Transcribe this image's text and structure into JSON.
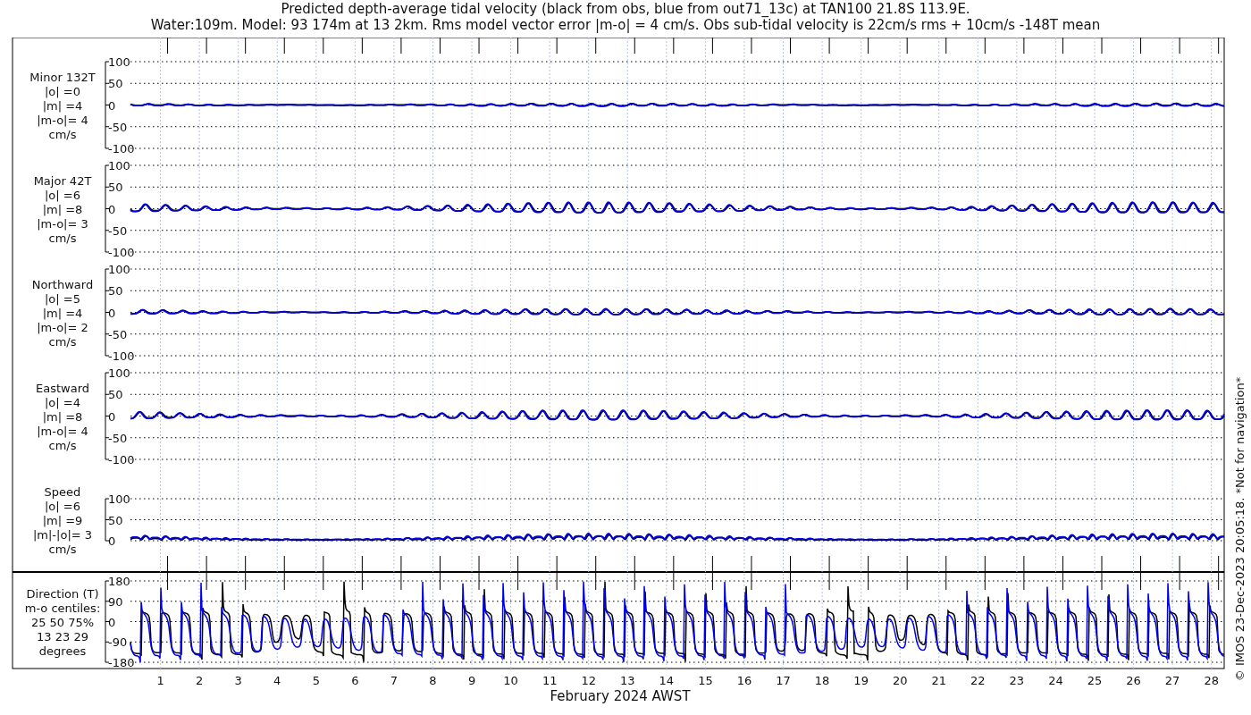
{
  "title_lines": [
    "Predicted depth-average tidal velocity (black from obs, blue from out71_13c) at TAN100 21.8S 113.9E.",
    "Water:109m. Model: 93 174m at 13 2km. Rms model vector error |m-o| = 4 cm/s. Obs sub-tidal velocity is 22cm/s rms + 10cm/s -148T mean"
  ],
  "panels": [
    {
      "kind": "velocity",
      "label": [
        "Minor 132T",
        "|o| =0",
        "|m| =4",
        "|m-o|= 4",
        "cm/s"
      ],
      "yticks": [
        "100",
        "50",
        "0",
        "-50",
        "-100"
      ]
    },
    {
      "kind": "velocity",
      "label": [
        "Major 42T",
        "|o| =6",
        "|m| =8",
        "|m-o|= 3",
        "cm/s"
      ],
      "yticks": [
        "100",
        "50",
        "0",
        "-50",
        "-100"
      ]
    },
    {
      "kind": "velocity",
      "label": [
        "Northward",
        "|o| =5",
        "|m| =4",
        "|m-o|= 2",
        "cm/s"
      ],
      "yticks": [
        "100",
        "50",
        "0",
        "-50",
        "-100"
      ]
    },
    {
      "kind": "velocity",
      "label": [
        "Eastward",
        "|o| =4",
        "|m| =8",
        "|m-o|= 4",
        "cm/s"
      ],
      "yticks": [
        "100",
        "50",
        "0",
        "-50",
        "-100"
      ]
    },
    {
      "kind": "speed",
      "label": [
        "Speed",
        "|o| =6",
        "|m| =9",
        "|m|-|o|= 3",
        "cm/s"
      ],
      "yticks": [
        "100",
        "50",
        "0"
      ]
    },
    {
      "kind": "direction",
      "label": [
        "Direction (T)",
        "m-o centiles:",
        "25  50  75%",
        "13  23  29",
        "degrees"
      ],
      "yticks": [
        "180",
        "90",
        "0",
        "-90",
        "-180"
      ]
    }
  ],
  "x_tick_labels": [
    "1",
    "2",
    "3",
    "4",
    "5",
    "6",
    "7",
    "8",
    "9",
    "10",
    "11",
    "12",
    "13",
    "14",
    "15",
    "16",
    "17",
    "18",
    "19",
    "20",
    "21",
    "22",
    "23",
    "24",
    "25",
    "26",
    "27",
    "28"
  ],
  "xlabel": "February 2024 AWST",
  "footer_note": "© IMOS 23-Dec-2023 20:05:18.  *Not for navigation*"
}
